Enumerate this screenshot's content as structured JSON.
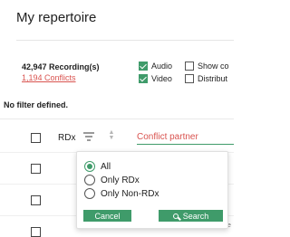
{
  "header": {
    "title": "My repertoire"
  },
  "summary": {
    "recordings": "42,947 Recording(s)",
    "conflicts": "1,194 Conflicts"
  },
  "media_filters": [
    {
      "label": "Audio",
      "checked": true
    },
    {
      "label": "Show co",
      "checked": false
    },
    {
      "label": "Video",
      "checked": true
    },
    {
      "label": "Distribut",
      "checked": false
    }
  ],
  "filter_status": "No filter defined.",
  "table": {
    "column_label": "RDx",
    "conflict_partner_placeholder": "Conflict partner",
    "trailing_text": "e"
  },
  "rdx_filter_popup": {
    "options": [
      {
        "label": "All",
        "selected": true
      },
      {
        "label": "Only RDx",
        "selected": false
      },
      {
        "label": "Only Non-RDx",
        "selected": false
      }
    ],
    "cancel_label": "Cancel",
    "search_label": "Search"
  },
  "colors": {
    "accent": "#3f9b6a",
    "conflict": "#d9534f"
  }
}
